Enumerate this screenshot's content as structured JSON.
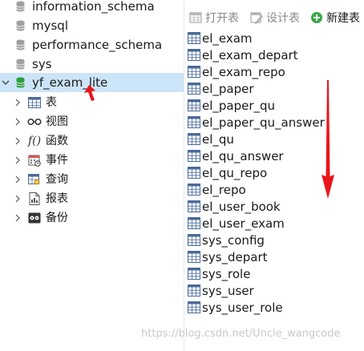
{
  "navigator": {
    "databases": [
      {
        "label": "information_schema",
        "icon": "database-icon"
      },
      {
        "label": "mysql",
        "icon": "database-icon"
      },
      {
        "label": "performance_schema",
        "icon": "database-icon"
      },
      {
        "label": "sys",
        "icon": "database-icon"
      },
      {
        "label": "yf_exam_lite",
        "icon": "database-icon",
        "selected": true,
        "expanded": true
      }
    ],
    "children": [
      {
        "label": "表",
        "icon": "table-icon"
      },
      {
        "label": "视图",
        "icon": "view-icon"
      },
      {
        "label": "函数",
        "icon": "function-icon"
      },
      {
        "label": "事件",
        "icon": "event-icon"
      },
      {
        "label": "查询",
        "icon": "query-icon"
      },
      {
        "label": "报表",
        "icon": "report-icon"
      },
      {
        "label": "备份",
        "icon": "backup-icon"
      }
    ]
  },
  "toolbar": {
    "open_table": "打开表",
    "design_table": "设计表",
    "new_table": "新建表"
  },
  "tables": [
    "el_exam",
    "el_exam_depart",
    "el_exam_repo",
    "el_paper",
    "el_paper_qu",
    "el_paper_qu_answer",
    "el_qu",
    "el_qu_answer",
    "el_qu_repo",
    "el_repo",
    "el_user_book",
    "el_user_exam",
    "sys_config",
    "sys_depart",
    "sys_role",
    "sys_user",
    "sys_user_role"
  ],
  "watermark": "https://blog.csdn.net/Uncle_wangcode",
  "colors": {
    "selection": "#cce4f7",
    "db_active": "#2e9e3e",
    "db_inactive": "#9a9a9a",
    "annotation_red": "#e8161b"
  }
}
